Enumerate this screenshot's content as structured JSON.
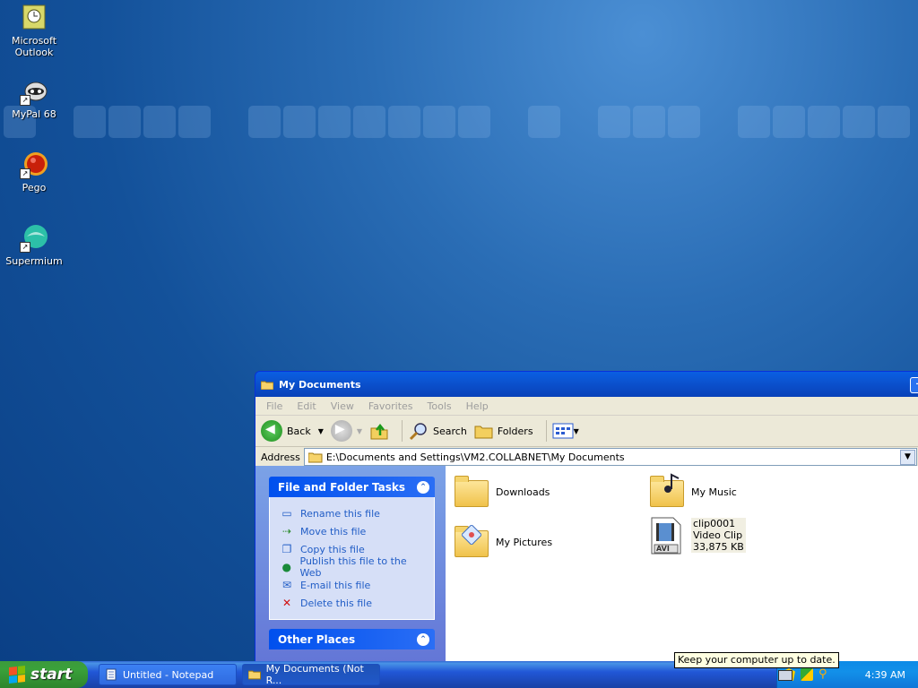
{
  "desktop": {
    "icons": [
      {
        "label_line1": "Microsoft",
        "label_line2": "Outlook",
        "icon": "outlook-icon"
      },
      {
        "label_line1": "MyPal 68",
        "label_line2": "",
        "icon": "raccoon-icon"
      },
      {
        "label_line1": "Pego",
        "label_line2": "",
        "icon": "pego-icon"
      },
      {
        "label_line1": "Supermium",
        "label_line2": "",
        "icon": "supermium-icon"
      }
    ]
  },
  "window": {
    "title": "My Documents",
    "menu": [
      "File",
      "Edit",
      "View",
      "Favorites",
      "Tools",
      "Help"
    ],
    "toolbar": {
      "back": "Back",
      "search": "Search",
      "folders": "Folders"
    },
    "address": {
      "label": "Address",
      "value": "E:\\Documents and Settings\\VM2.COLLABNET\\My Documents"
    },
    "tasks_panel": {
      "title": "File and Folder Tasks",
      "items": [
        {
          "label": "Rename this file",
          "icon": "rename-icon"
        },
        {
          "label": "Move this file",
          "icon": "move-icon"
        },
        {
          "label": "Copy this file",
          "icon": "copy-icon"
        },
        {
          "label": "Publish this file to the Web",
          "icon": "globe-icon"
        },
        {
          "label": "E-mail this file",
          "icon": "email-icon"
        },
        {
          "label": "Delete this file",
          "icon": "delete-icon"
        }
      ]
    },
    "other_places_panel": {
      "title": "Other Places"
    },
    "files": [
      {
        "name": "Downloads",
        "type": "folder"
      },
      {
        "name": "My Music",
        "type": "folder"
      },
      {
        "name": "My Pictures",
        "type": "folder"
      },
      {
        "name": "clip0001",
        "type_label": "Video Clip",
        "size": "33,875 KB",
        "badge": "AVI"
      }
    ]
  },
  "taskbar": {
    "start_label": "start",
    "buttons": [
      "Untitled - Notepad",
      "My Documents (Not R..."
    ],
    "clock": "4:39 AM",
    "tooltip": "Keep your computer up to date."
  }
}
